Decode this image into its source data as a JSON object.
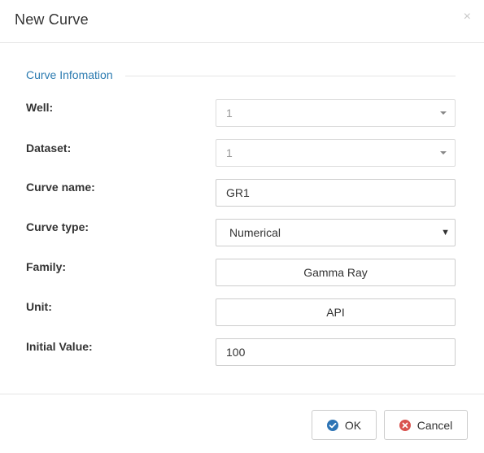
{
  "dialog": {
    "title": "New Curve",
    "close_glyph": "×"
  },
  "section": {
    "legend": "Curve Infomation"
  },
  "fields": {
    "well": {
      "label": "Well:",
      "value": "1"
    },
    "dataset": {
      "label": "Dataset:",
      "value": "1"
    },
    "curve_name": {
      "label": "Curve name:",
      "value": "GR1"
    },
    "curve_type": {
      "label": "Curve type:",
      "value": "Numerical",
      "arrow": "▼"
    },
    "family": {
      "label": "Family:",
      "value": "Gamma Ray"
    },
    "unit": {
      "label": "Unit:",
      "value": "API"
    },
    "initial_value": {
      "label": "Initial Value:",
      "value": "100"
    }
  },
  "footer": {
    "ok_label": "OK",
    "cancel_label": "Cancel"
  },
  "icons": {
    "ok": "check-circle-icon",
    "cancel": "x-circle-icon",
    "close": "close-icon"
  },
  "colors": {
    "accent": "#2a7ab0",
    "ok_icon": "#2d74b5",
    "cancel_icon": "#d9534f",
    "border": "#cccccc",
    "disabled_text": "#999999"
  }
}
